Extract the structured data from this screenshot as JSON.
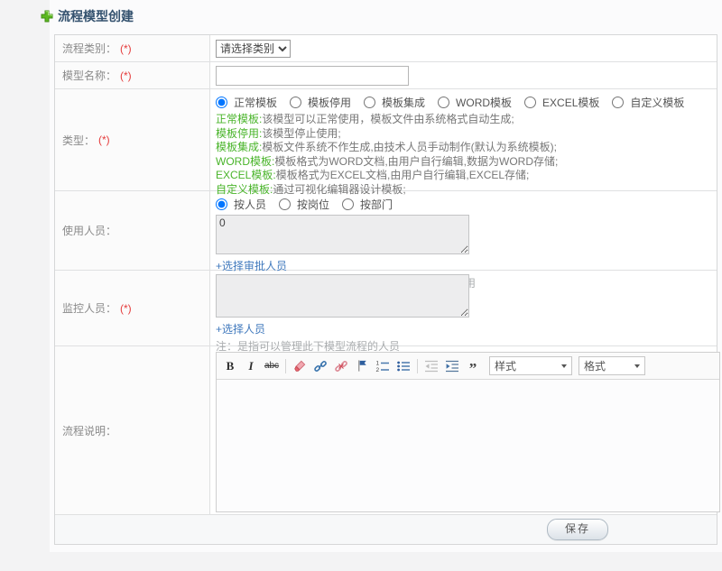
{
  "header": {
    "title": "流程模型创建"
  },
  "colors": {
    "term_green": "#49b42a",
    "link_blue": "#4079bd",
    "required_red": "#e53c3c",
    "title_navy": "#33516e"
  },
  "form": {
    "category": {
      "label": "流程类别：",
      "required": "(*)",
      "select_value": "请选择类别"
    },
    "name": {
      "label": "模型名称：",
      "required": "(*)",
      "value": ""
    },
    "type": {
      "label": "类型：",
      "required": "(*)",
      "options": [
        {
          "label": "正常模板",
          "checked": "checked"
        },
        {
          "label": "模板停用"
        },
        {
          "label": "模板集成"
        },
        {
          "label": "WORD模板"
        },
        {
          "label": "EXCEL模板"
        },
        {
          "label": "自定义模板"
        }
      ],
      "descriptions": [
        {
          "term": "正常模板:",
          "text": "该模型可以正常使用，模板文件由系统格式自动生成;"
        },
        {
          "term": "模板停用:",
          "text": "该模型停止使用;"
        },
        {
          "term": "模板集成:",
          "text": "模板文件系统不作生成,由技术人员手动制作(默认为系统模板);"
        },
        {
          "term": "WORD模板:",
          "text": "模板格式为WORD文档,由用户自行编辑,数据为WORD存储;"
        },
        {
          "term": "EXCEL模板:",
          "text": "模板格式为EXCEL文档,由用户自行编辑,EXCEL存储;"
        },
        {
          "term": "自定义模板:",
          "text": "通过可视化编辑器设计模板;"
        }
      ]
    },
    "users": {
      "label": "使用人员：",
      "options": [
        {
          "label": "按人员",
          "checked": "checked"
        },
        {
          "label": "按岗位"
        },
        {
          "label": "按部门"
        }
      ],
      "textarea_value": "0",
      "link_label": "+选择审批人员",
      "note": "注：是指允许使用此模型的人员，留空为全体人员使用"
    },
    "monitor": {
      "label": "监控人员：",
      "required": "(*)",
      "textarea_value": "",
      "link_label": "+选择人员",
      "note": "注：是指可以管理此下模型流程的人员"
    },
    "description": {
      "label": "流程说明：",
      "editor": {
        "styles_label": "样式",
        "format_label": "格式",
        "icons": {
          "bold": "B",
          "italic": "I",
          "strike": "abc",
          "quote": "”"
        },
        "buttons": [
          "bold",
          "italic",
          "strikethrough",
          "remove-format",
          "link",
          "unlink",
          "anchor",
          "numbered-list",
          "bulleted-list",
          "outdent",
          "indent",
          "blockquote"
        ]
      }
    },
    "footer": {
      "save_label": "保存"
    }
  }
}
